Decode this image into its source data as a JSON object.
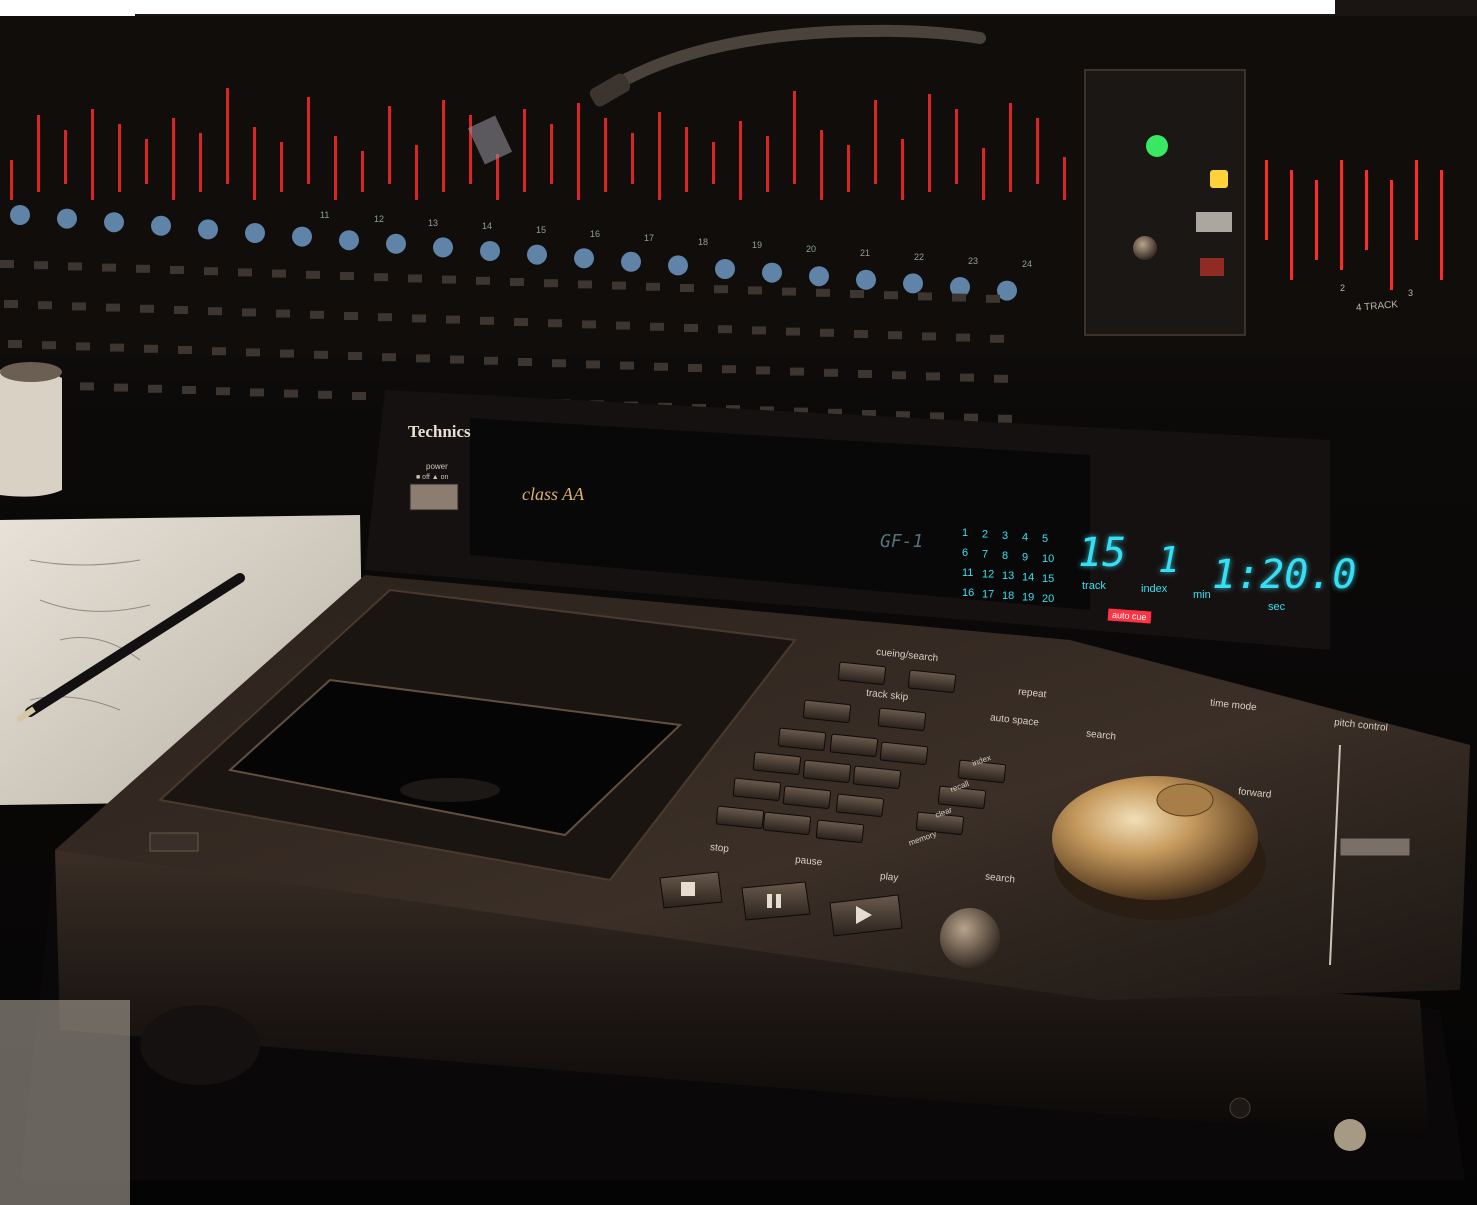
{
  "photo": {
    "brand": "Technics",
    "class_logo": "class AA",
    "power": {
      "label": "power",
      "states": "■ off  ▲ on"
    },
    "display": {
      "model": "GF-1",
      "track": "15",
      "index": "1",
      "time": "1:20.0",
      "track_label": "track",
      "index_label": "index",
      "min_label": "min",
      "sec_label": "sec",
      "auto_cue": "auto cue",
      "track_grid": [
        "1",
        "2",
        "3",
        "4",
        "5",
        "6",
        "7",
        "8",
        "9",
        "10",
        "11",
        "12",
        "13",
        "14",
        "15",
        "16",
        "17",
        "18",
        "19",
        "20"
      ]
    },
    "controls": {
      "cueing_search": "cueing/search",
      "track_skip": "track skip",
      "repeat": "repeat",
      "auto_space": "auto space",
      "time_mode": "time mode",
      "search": "search",
      "pitch_control": "pitch control",
      "stop": "stop",
      "pause": "pause",
      "play": "play",
      "search_slow_fast": "search",
      "forward": "forward",
      "memory": "memory",
      "index": "index",
      "recall": "recall",
      "clear": "clear"
    },
    "console": {
      "channel_numbers": [
        "11",
        "12",
        "13",
        "14",
        "15",
        "16",
        "17",
        "18",
        "19",
        "20",
        "21",
        "22",
        "23",
        "24"
      ],
      "four_track": "4 TRACK",
      "meter_numbers": [
        "2",
        "3"
      ]
    }
  },
  "colors": {
    "background": "#0d0b0a",
    "vfd": "#35e0f5",
    "meter_red": "#ff2a2a",
    "led_green": "#3cff6a",
    "led_yellow": "#ffd23a",
    "gold_knob": "#c9a46a"
  }
}
